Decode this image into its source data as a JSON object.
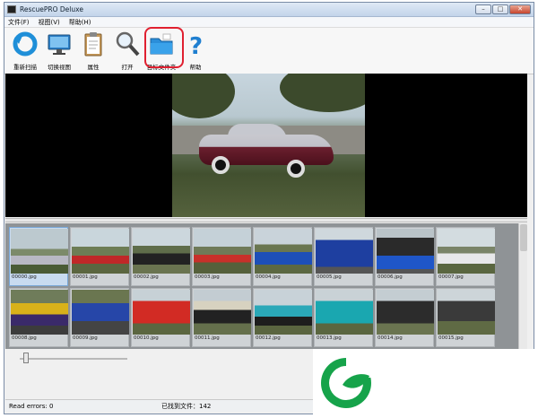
{
  "window": {
    "title": "RescuePRO Deluxe",
    "controls": {
      "minimize": "–",
      "maximize": "□",
      "close": "✕"
    }
  },
  "menu": [
    {
      "label": "文件(F)"
    },
    {
      "label": "视图(V)"
    },
    {
      "label": "帮助(H)"
    }
  ],
  "toolbar": [
    {
      "label": "重新扫描",
      "icon": "rescan-icon"
    },
    {
      "label": "切换视图",
      "icon": "monitor-icon"
    },
    {
      "label": "属性",
      "icon": "clipboard-icon"
    },
    {
      "label": "打开",
      "icon": "magnifier-icon"
    },
    {
      "label": "目标文件夹",
      "icon": "folder-icon"
    },
    {
      "label": "帮助",
      "icon": "help-icon"
    }
  ],
  "thumbnails": [
    {
      "name": "00000.jpg"
    },
    {
      "name": "00001.jpg"
    },
    {
      "name": "00002.jpg"
    },
    {
      "name": "00003.jpg"
    },
    {
      "name": "00004.jpg"
    },
    {
      "name": "00005.jpg"
    },
    {
      "name": "00006.jpg"
    },
    {
      "name": "00007.jpg"
    },
    {
      "name": "00008.jpg"
    },
    {
      "name": "00009.jpg"
    },
    {
      "name": "00010.jpg"
    },
    {
      "name": "00011.jpg"
    },
    {
      "name": "00012.jpg"
    },
    {
      "name": "00013.jpg"
    },
    {
      "name": "00014.jpg"
    },
    {
      "name": "00015.jpg"
    },
    {
      "name": ""
    },
    {
      "name": ""
    },
    {
      "name": ""
    },
    {
      "name": ""
    },
    {
      "name": ""
    }
  ],
  "status": {
    "errors": "Read errors: 0",
    "found": "已找到文件：142"
  },
  "colors": {
    "selection": "#c8dbf0",
    "highlight": "#e02030",
    "logo_green": "#16a34a"
  }
}
